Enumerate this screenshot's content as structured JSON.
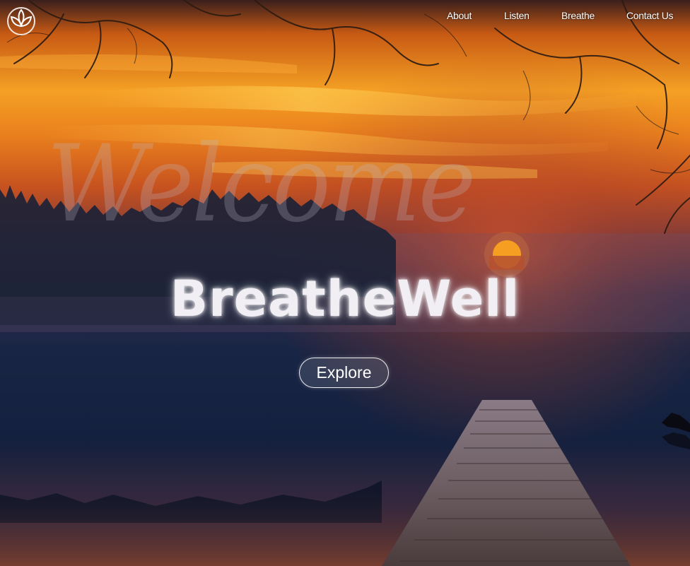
{
  "nav": {
    "items": [
      {
        "label": "About"
      },
      {
        "label": "Listen"
      },
      {
        "label": "Breathe"
      },
      {
        "label": "Contact Us"
      }
    ]
  },
  "hero": {
    "welcome_text": "Welcome",
    "brand_name": "BreatheWell",
    "cta_label": "Explore"
  },
  "icons": {
    "logo": "lotus-icon"
  },
  "colors": {
    "sky_top": "#e87a1a",
    "sky_glow": "#f7b130",
    "water_dark": "#0f1e3c",
    "dock": "#6b5a5a",
    "sun": "#f59a1a"
  }
}
